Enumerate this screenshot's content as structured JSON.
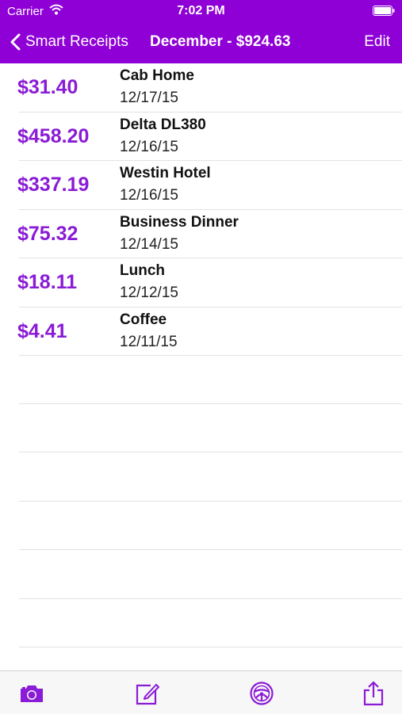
{
  "status": {
    "carrier": "Carrier",
    "time": "7:02 PM"
  },
  "nav": {
    "back_label": "Smart Receipts",
    "title": "December - $924.63",
    "edit_label": "Edit"
  },
  "colors": {
    "header": "#8e00d6",
    "amount": "#8a1bd6",
    "icon": "#8a1bd6"
  },
  "receipts": [
    {
      "amount": "$31.40",
      "name": "Cab Home",
      "date": "12/17/15"
    },
    {
      "amount": "$458.20",
      "name": "Delta DL380",
      "date": "12/16/15"
    },
    {
      "amount": "$337.19",
      "name": "Westin Hotel",
      "date": "12/16/15"
    },
    {
      "amount": "$75.32",
      "name": "Business Dinner",
      "date": "12/14/15"
    },
    {
      "amount": "$18.11",
      "name": "Lunch",
      "date": "12/12/15"
    },
    {
      "amount": "$4.41",
      "name": "Coffee",
      "date": "12/11/15"
    }
  ],
  "toolbar": {
    "icons": [
      "camera-icon",
      "compose-icon",
      "steering-wheel-icon",
      "share-icon"
    ]
  }
}
